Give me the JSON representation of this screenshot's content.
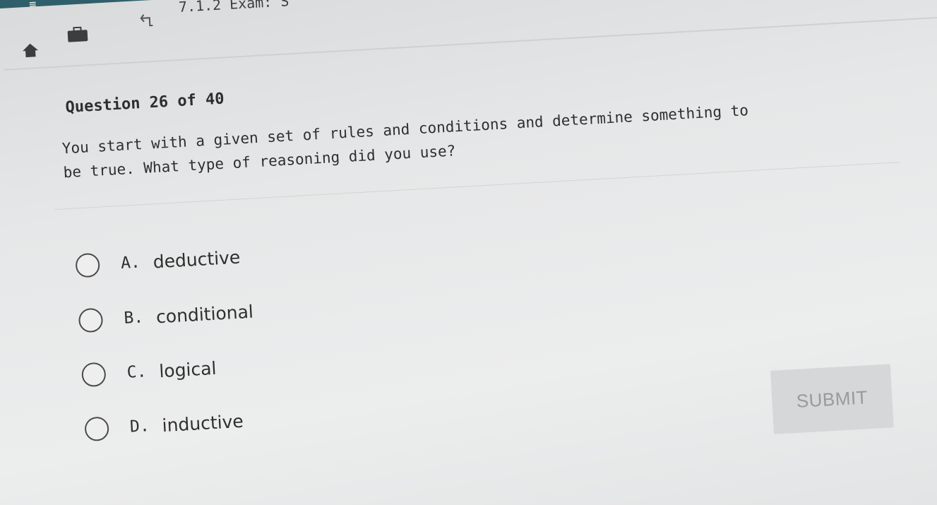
{
  "header": {
    "menu_icon": "hamburger-menu-icon",
    "home_icon": "home-icon",
    "briefcase_icon": "briefcase-icon",
    "back_icon": "back-arrow-icon",
    "breadcrumb": "7.1.2 Exam: S"
  },
  "question": {
    "number_label": "Question 26 of 40",
    "text_line1": "You start with a given set of rules and conditions and determine something to",
    "text_line2": "be true. What type of reasoning did you use?"
  },
  "options": [
    {
      "letter": "A.",
      "text": "deductive"
    },
    {
      "letter": "B.",
      "text": "conditional"
    },
    {
      "letter": "C.",
      "text": "logical"
    },
    {
      "letter": "D.",
      "text": "inductive"
    }
  ],
  "submit": {
    "label": "SUBMIT"
  }
}
